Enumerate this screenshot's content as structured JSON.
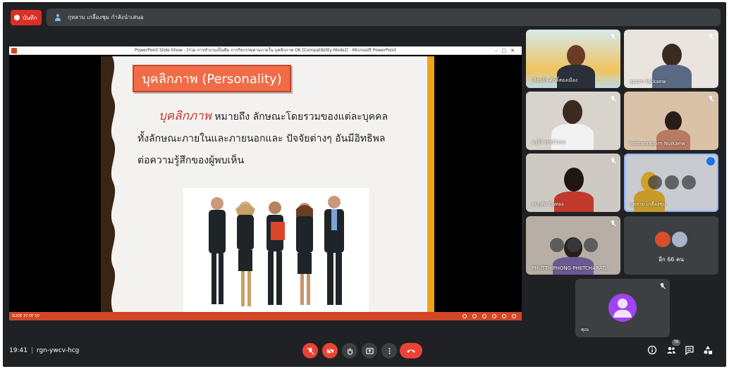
{
  "top_bar": {
    "record_label": "บันทึก",
    "presenter_text": "กุหลาบ เกลื่องชุม กำลังนำเสนอ"
  },
  "presentation": {
    "window_title": "PowerPoint Slide Show - [ร่วม การทำงานเป็นทีม การกิจกรรมตามภายใน บุคลิกภาพ OK [Compatibility Mode]] - Microsoft PowerPoint",
    "slide_title": "บุคลิกภาพ (Personality)",
    "body_highlight": "บุคลิกภาพ",
    "body_line1_rest": " หมายถึง ลักษณะโดยรวมของแต่ละบุคคล",
    "body_line2": "ทั้งลักษณะภายในและภายนอกและ ปัจจัยต่างๆ อันมีอิทธิพล",
    "body_line3": "ต่อความรู้สึกของผู้พบเห็น",
    "status_text": "SLIDE 37 OF 50"
  },
  "participants": [
    {
      "name": "เลือนใจ ศักดิ์สองเมือง",
      "muted": true
    },
    {
      "name": "aporn fakkaew",
      "muted": true
    },
    {
      "name": "ครูโจ้ ทักษ์วังพล",
      "muted": true
    },
    {
      "name": "Pathamaporn Nuikaew",
      "muted": true
    },
    {
      "name": "สมฤทัย ปิ่นทอง",
      "muted": true
    },
    {
      "name": "กุหลาบ เกลื่องชุม",
      "muted": false
    },
    {
      "name": "PHUTTHIPHONG PHETCHARAT...",
      "muted": true
    },
    {
      "name": "คุณ",
      "muted": true
    }
  ],
  "more_participants": "อีก 66 คน",
  "bottom_bar": {
    "time": "19:41",
    "meeting_code": "rgn-ywcv-hcg",
    "people_count": "76"
  },
  "colors": {
    "background": "#202124",
    "tile": "#3c4043",
    "danger": "#ea4335",
    "slide_title": "#f06c47",
    "slide_accent": "#f2a31c"
  }
}
